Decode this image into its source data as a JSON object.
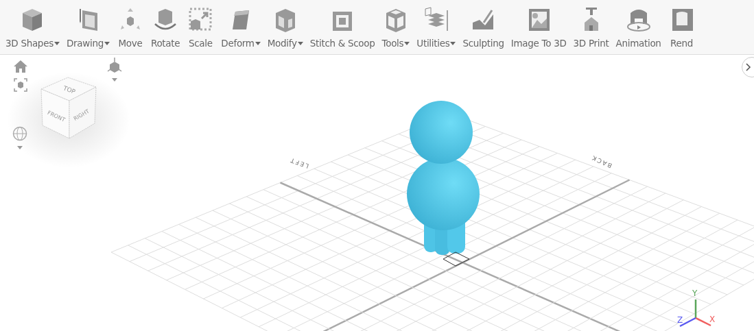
{
  "toolbar": [
    {
      "label": "3D Shapes",
      "dropdown": true
    },
    {
      "label": "Drawing",
      "dropdown": true
    },
    {
      "label": "Move",
      "dropdown": false
    },
    {
      "label": "Rotate",
      "dropdown": false
    },
    {
      "label": "Scale",
      "dropdown": false
    },
    {
      "label": "Deform",
      "dropdown": true
    },
    {
      "label": "Modify",
      "dropdown": true
    },
    {
      "label": "Stitch & Scoop",
      "dropdown": false
    },
    {
      "label": "Tools",
      "dropdown": true
    },
    {
      "label": "Utilities",
      "dropdown": true
    },
    {
      "label": "Sculpting",
      "dropdown": false
    },
    {
      "label": "Image To 3D",
      "dropdown": false
    },
    {
      "label": "3D Print",
      "dropdown": false
    },
    {
      "label": "Animation",
      "dropdown": false
    },
    {
      "label": "Rend",
      "dropdown": false
    }
  ],
  "view_cube": {
    "faces": [
      "TOP",
      "FRONT",
      "RIGHT"
    ]
  },
  "grid_labels": [
    "LEFT",
    "BACK"
  ],
  "axes": [
    "X",
    "Y",
    "Z"
  ]
}
